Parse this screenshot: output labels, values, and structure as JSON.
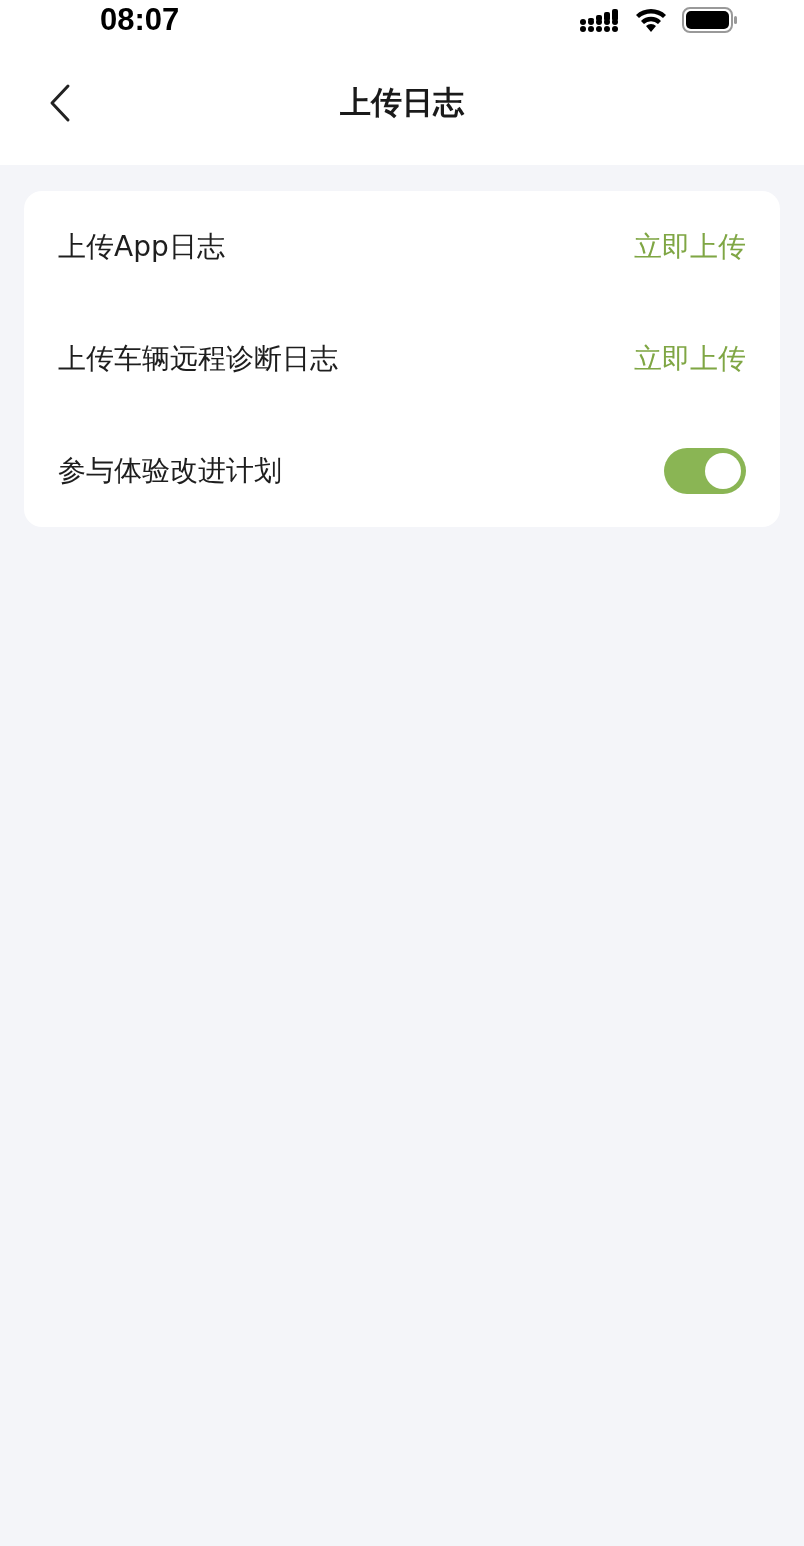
{
  "status_bar": {
    "time": "08:07"
  },
  "nav": {
    "title": "上传日志"
  },
  "rows": [
    {
      "kind": "action",
      "label": "上传App日志",
      "action": "立即上传"
    },
    {
      "kind": "action",
      "label": "上传车辆远程诊断日志",
      "action": "立即上传"
    },
    {
      "kind": "toggle",
      "label": "参与体验改进计划",
      "on": true
    }
  ]
}
